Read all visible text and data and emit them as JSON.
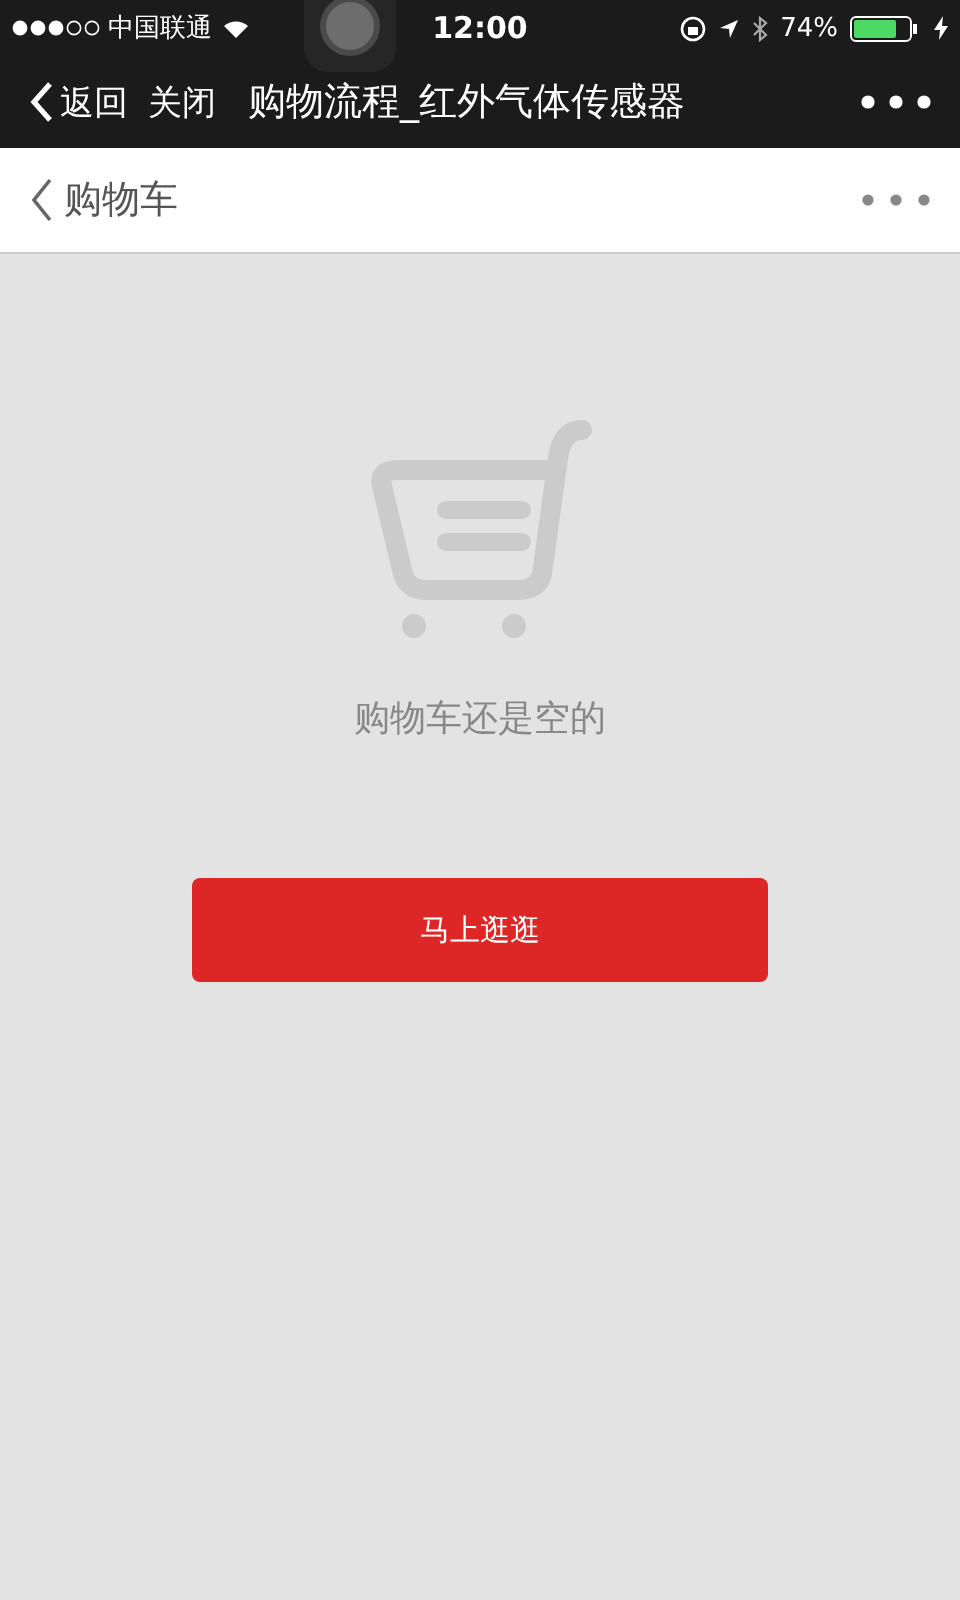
{
  "status_bar": {
    "carrier": "中国联通",
    "time": "12:00",
    "battery": "74%"
  },
  "nav_bar": {
    "back": "返回",
    "close": "关闭",
    "title": "购物流程_红外气体传感器"
  },
  "page_header": {
    "title": "购物车"
  },
  "empty_state": {
    "message": "购物车还是空的",
    "button": "马上逛逛"
  }
}
